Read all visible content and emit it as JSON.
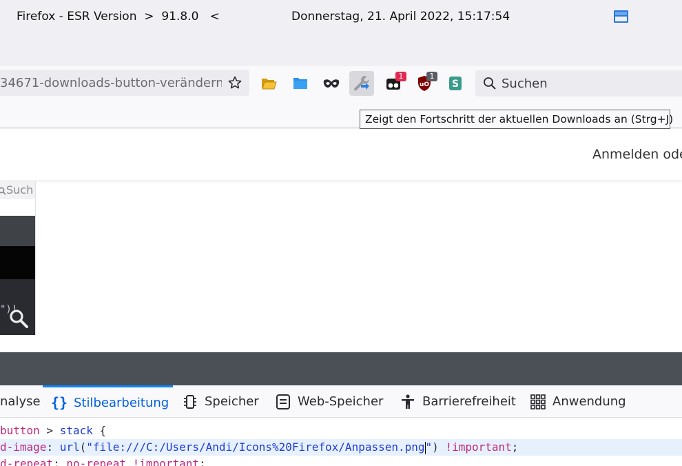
{
  "titlebar": {
    "left": "Firefox - ESR Version  >  91.8.0   <",
    "center": "Donnerstag, 21. April 2022, 15:17:54"
  },
  "urlbar": {
    "url": "34671-downloads-button-verändern"
  },
  "toolbar": {
    "badges": {
      "extension_a": "1",
      "ublock": "1"
    },
    "search_placeholder": "Suchen",
    "tooltip": "Zeigt den Fortschritt der aktuellen Downloads an (Strg+J)"
  },
  "page": {
    "signin": "Anmelden ode",
    "thumb_search": "Such",
    "thumb_code": "\")!"
  },
  "devtools": {
    "tabs": [
      {
        "label": "nalyse",
        "icon": "performance-icon"
      },
      {
        "label": "Stilbearbeitung",
        "icon": "braces-icon",
        "selected": true
      },
      {
        "label": "Speicher",
        "icon": "memory-chip-icon"
      },
      {
        "label": "Web-Speicher",
        "icon": "storage-icon"
      },
      {
        "label": "Barrierefreiheit",
        "icon": "accessibility-icon"
      },
      {
        "label": "Anwendung",
        "icon": "grid-icon"
      }
    ],
    "code": {
      "line1_sel": "button",
      "line1_combinator": " > ",
      "line1_tag": "stack",
      "line1_brace": " {",
      "line2_prop": "d-image",
      "line2_colon": ": ",
      "line2_fn": "url",
      "line2_open": "(",
      "line2_str_a": "\"file:///C:/Users/Andi/Icons%20Firefox/Anpassen.png",
      "line2_str_b": "\"",
      "line2_close": ") ",
      "line2_imp": "!important",
      "line2_semi": ";",
      "line3_prop": "d-repeat",
      "line3_colon": ": ",
      "line3_val": "no-repeat",
      "line3_imp": " !important",
      "line3_semi": ";"
    }
  },
  "colors": {
    "accent": "#0a84ff",
    "badge_red": "#e22850",
    "ublock_red": "#800000",
    "folder_blue": "#2a90e8",
    "folder_yellow": "#f0b020"
  }
}
